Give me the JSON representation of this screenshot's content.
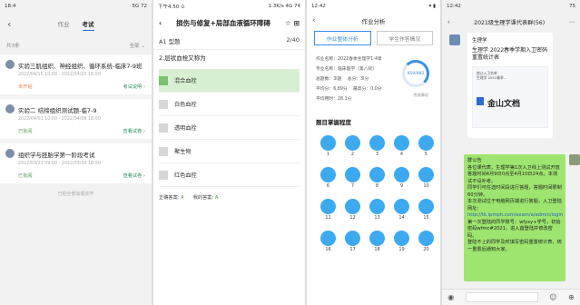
{
  "p1": {
    "status_left": "18:4",
    "status_right": "5G 72",
    "tabs": [
      "作业",
      "考试"
    ],
    "count": "共3条",
    "filter": "全部 ⌄",
    "cards": [
      {
        "title": "实验三肌组织、神经组织、循环系统-临床7-9班",
        "date": "2022/04/15 10:00 - 2022/04/15 18:00",
        "status": "未开始",
        "link": "考试说明 ›"
      },
      {
        "title": "实验二 结缔组织测试题-临7-9",
        "date": "2022/04/01 10:00 - 2022/04/08 18:00",
        "status": "已批阅",
        "link": "查看试卷 ›"
      },
      {
        "title": "组织学与胚胎学第一阶段考试",
        "date": "2022/03/23 09:00 - 2022/03/30 18:00",
        "status": "已批阅",
        "link": "查看试卷 ›"
      }
    ],
    "footer": "已经全部加载完毕"
  },
  "p2": {
    "status_left": "下午4:50 ⊙",
    "status_right": "1.3K/s 4G 74",
    "title": "损伤与修复+局部血液循环障碍",
    "qtype": "A1 型题",
    "progress": "2/40",
    "question": "2.层状血栓又称为",
    "options": [
      {
        "l": "A",
        "t": "混合血栓"
      },
      {
        "l": "B",
        "t": "白色血栓"
      },
      {
        "l": "C",
        "t": "透明血栓"
      },
      {
        "l": "D",
        "t": "聚生物"
      },
      {
        "l": "E",
        "t": "红色血栓"
      }
    ],
    "ans_correct_lbl": "正确答案:",
    "ans_correct": "A",
    "ans_mine_lbl": "我的答案:",
    "ans_mine": "A"
  },
  "p3": {
    "status_left": "12:42",
    "status_right": "▾ ▮",
    "title": "作业分析",
    "tabs": [
      "作业整体分析",
      "学生作答情况"
    ],
    "info": [
      "作业名称：2022春季生理学1-4章",
      "专业名称：临床医学（第八轮）",
      "总题数：3l题　 总分：3l分",
      "平均分：6.89分　 最高分：0.0分",
      "平均用时：28.1分"
    ],
    "ring": "859/982",
    "ring_lbl": "完成情况",
    "section": "题目掌握程度",
    "nums": [
      "1",
      "2",
      "3",
      "4",
      "5",
      "6",
      "7",
      "8",
      "9",
      "10",
      "11",
      "12",
      "13",
      "14",
      "15",
      "16",
      "17",
      "18",
      "19",
      "20"
    ]
  },
  "p4": {
    "status_left": "12:42",
    "status_right": "75",
    "title": "2021级生理学课代表群(56)",
    "sender": "生理学",
    "msg": "生理学 2022春季学期入卫密码重置统计表",
    "logo": "金山文档",
    "doc_lines": [
      "统计入卫名单",
      "生理学 2022春季..."
    ],
    "notice": [
      "群公告",
      "各位课代表，生理学第1次入卫线上测试开放答题时间4月9日0点至4月10日24点。本测试不设补考。",
      "同学们可任选时间段进行答题，答题时间限制60分钟。",
      "本次测试位于电脑网页端进行答题，入卫登陆网址：",
      "http://tk.ipmph.com/exam/a/admin/login",
      "第一次登陆的同学账号：wfyxy+学号，初始密码wfmc#2021，进入首登陆并修改密码。",
      "登陆不上的同学及时填写密码重置统计表，统一重置后通知大家。"
    ]
  }
}
